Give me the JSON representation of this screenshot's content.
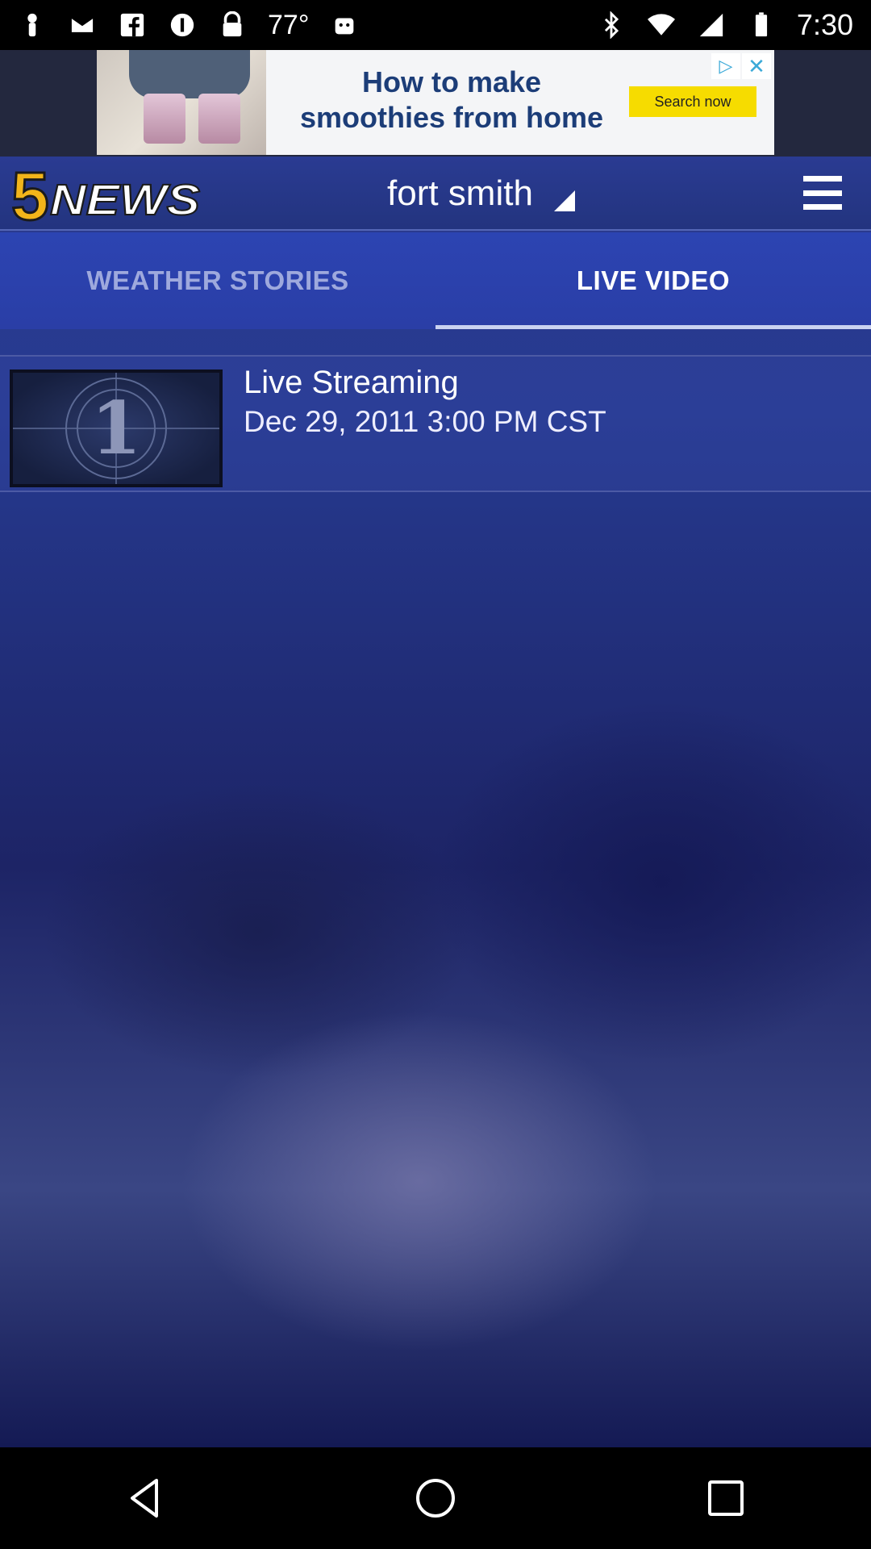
{
  "status_bar": {
    "temperature": "77°",
    "time": "7:30",
    "left_icons": [
      "person-icon",
      "mail-icon",
      "facebook-icon",
      "info-icon",
      "lock-icon",
      "android-icon"
    ],
    "right_icons": [
      "bluetooth-icon",
      "wifi-icon",
      "signal-icon",
      "battery-icon"
    ]
  },
  "ad": {
    "headline": "How to make smoothies from home",
    "cta": "Search now",
    "close_label": "✕",
    "choice_label": "▷"
  },
  "header": {
    "logo_text": "5NEWS",
    "location": "fort smith"
  },
  "tabs": [
    {
      "label": "WEATHER STORIES",
      "active": false
    },
    {
      "label": "LIVE VIDEO",
      "active": true
    }
  ],
  "videos": [
    {
      "title": "Live Streaming",
      "date": "Dec 29, 2011 3:00 PM CST",
      "thumb_number": "1"
    }
  ],
  "colors": {
    "header_bg": "#2a3b92",
    "tab_bg": "#2c44b2",
    "tab_active_text": "#ffffff",
    "tab_inactive_text": "#9ea9dd",
    "logo_yellow": "#f2b51a"
  }
}
